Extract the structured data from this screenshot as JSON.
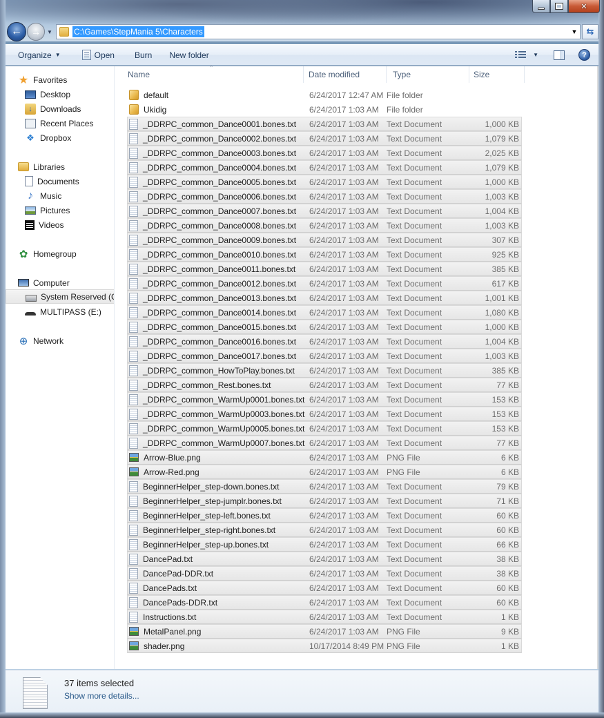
{
  "window": {
    "minimize_label": "Minimize",
    "maximize_label": "Maximize",
    "close_label": "Close"
  },
  "navbar": {
    "back_glyph": "←",
    "forward_glyph": "→",
    "recent_glyph": "▼",
    "address": "C:\\Games\\StepMania 5\\Characters",
    "address_dropdown_glyph": "▼",
    "refresh_glyph": "⇆"
  },
  "toolbar": {
    "organize": "Organize",
    "organize_arrow": "▼",
    "open": "Open",
    "burn": "Burn",
    "new_folder": "New folder",
    "views_arrow": "▼",
    "help_glyph": "?"
  },
  "sidebar": {
    "favorites": {
      "label": "Favorites",
      "items": [
        "Desktop",
        "Downloads",
        "Recent Places",
        "Dropbox"
      ]
    },
    "libraries": {
      "label": "Libraries",
      "items": [
        "Documents",
        "Music",
        "Pictures",
        "Videos"
      ]
    },
    "homegroup": {
      "label": "Homegroup"
    },
    "computer": {
      "label": "Computer",
      "items": [
        "System Reserved (C:",
        "MULTIPASS (E:)"
      ]
    },
    "network": {
      "label": "Network"
    }
  },
  "columns": {
    "name": "Name",
    "date": "Date modified",
    "type": "Type",
    "size": "Size",
    "sort_glyph": "^"
  },
  "files": [
    {
      "name": "default",
      "date": "6/24/2017 12:47 AM",
      "type": "File folder",
      "size": "",
      "icon": "folder",
      "selected": false
    },
    {
      "name": "Ukidig",
      "date": "6/24/2017 1:03 AM",
      "type": "File folder",
      "size": "",
      "icon": "folder",
      "selected": false
    },
    {
      "name": "_DDRPC_common_Dance0001.bones.txt",
      "date": "6/24/2017 1:03 AM",
      "type": "Text Document",
      "size": "1,000 KB",
      "icon": "txt",
      "selected": true
    },
    {
      "name": "_DDRPC_common_Dance0002.bones.txt",
      "date": "6/24/2017 1:03 AM",
      "type": "Text Document",
      "size": "1,079 KB",
      "icon": "txt",
      "selected": true
    },
    {
      "name": "_DDRPC_common_Dance0003.bones.txt",
      "date": "6/24/2017 1:03 AM",
      "type": "Text Document",
      "size": "2,025 KB",
      "icon": "txt",
      "selected": true
    },
    {
      "name": "_DDRPC_common_Dance0004.bones.txt",
      "date": "6/24/2017 1:03 AM",
      "type": "Text Document",
      "size": "1,079 KB",
      "icon": "txt",
      "selected": true
    },
    {
      "name": "_DDRPC_common_Dance0005.bones.txt",
      "date": "6/24/2017 1:03 AM",
      "type": "Text Document",
      "size": "1,000 KB",
      "icon": "txt",
      "selected": true
    },
    {
      "name": "_DDRPC_common_Dance0006.bones.txt",
      "date": "6/24/2017 1:03 AM",
      "type": "Text Document",
      "size": "1,003 KB",
      "icon": "txt",
      "selected": true
    },
    {
      "name": "_DDRPC_common_Dance0007.bones.txt",
      "date": "6/24/2017 1:03 AM",
      "type": "Text Document",
      "size": "1,004 KB",
      "icon": "txt",
      "selected": true
    },
    {
      "name": "_DDRPC_common_Dance0008.bones.txt",
      "date": "6/24/2017 1:03 AM",
      "type": "Text Document",
      "size": "1,003 KB",
      "icon": "txt",
      "selected": true
    },
    {
      "name": "_DDRPC_common_Dance0009.bones.txt",
      "date": "6/24/2017 1:03 AM",
      "type": "Text Document",
      "size": "307 KB",
      "icon": "txt",
      "selected": true
    },
    {
      "name": "_DDRPC_common_Dance0010.bones.txt",
      "date": "6/24/2017 1:03 AM",
      "type": "Text Document",
      "size": "925 KB",
      "icon": "txt",
      "selected": true
    },
    {
      "name": "_DDRPC_common_Dance0011.bones.txt",
      "date": "6/24/2017 1:03 AM",
      "type": "Text Document",
      "size": "385 KB",
      "icon": "txt",
      "selected": true
    },
    {
      "name": "_DDRPC_common_Dance0012.bones.txt",
      "date": "6/24/2017 1:03 AM",
      "type": "Text Document",
      "size": "617 KB",
      "icon": "txt",
      "selected": true
    },
    {
      "name": "_DDRPC_common_Dance0013.bones.txt",
      "date": "6/24/2017 1:03 AM",
      "type": "Text Document",
      "size": "1,001 KB",
      "icon": "txt",
      "selected": true
    },
    {
      "name": "_DDRPC_common_Dance0014.bones.txt",
      "date": "6/24/2017 1:03 AM",
      "type": "Text Document",
      "size": "1,080 KB",
      "icon": "txt",
      "selected": true
    },
    {
      "name": "_DDRPC_common_Dance0015.bones.txt",
      "date": "6/24/2017 1:03 AM",
      "type": "Text Document",
      "size": "1,000 KB",
      "icon": "txt",
      "selected": true
    },
    {
      "name": "_DDRPC_common_Dance0016.bones.txt",
      "date": "6/24/2017 1:03 AM",
      "type": "Text Document",
      "size": "1,004 KB",
      "icon": "txt",
      "selected": true
    },
    {
      "name": "_DDRPC_common_Dance0017.bones.txt",
      "date": "6/24/2017 1:03 AM",
      "type": "Text Document",
      "size": "1,003 KB",
      "icon": "txt",
      "selected": true
    },
    {
      "name": "_DDRPC_common_HowToPlay.bones.txt",
      "date": "6/24/2017 1:03 AM",
      "type": "Text Document",
      "size": "385 KB",
      "icon": "txt",
      "selected": true
    },
    {
      "name": "_DDRPC_common_Rest.bones.txt",
      "date": "6/24/2017 1:03 AM",
      "type": "Text Document",
      "size": "77 KB",
      "icon": "txt",
      "selected": true
    },
    {
      "name": "_DDRPC_common_WarmUp0001.bones.txt",
      "date": "6/24/2017 1:03 AM",
      "type": "Text Document",
      "size": "153 KB",
      "icon": "txt",
      "selected": true
    },
    {
      "name": "_DDRPC_common_WarmUp0003.bones.txt",
      "date": "6/24/2017 1:03 AM",
      "type": "Text Document",
      "size": "153 KB",
      "icon": "txt",
      "selected": true
    },
    {
      "name": "_DDRPC_common_WarmUp0005.bones.txt",
      "date": "6/24/2017 1:03 AM",
      "type": "Text Document",
      "size": "153 KB",
      "icon": "txt",
      "selected": true
    },
    {
      "name": "_DDRPC_common_WarmUp0007.bones.txt",
      "date": "6/24/2017 1:03 AM",
      "type": "Text Document",
      "size": "77 KB",
      "icon": "txt",
      "selected": true
    },
    {
      "name": "Arrow-Blue.png",
      "date": "6/24/2017 1:03 AM",
      "type": "PNG File",
      "size": "6 KB",
      "icon": "png",
      "selected": true
    },
    {
      "name": "Arrow-Red.png",
      "date": "6/24/2017 1:03 AM",
      "type": "PNG File",
      "size": "6 KB",
      "icon": "png",
      "selected": true
    },
    {
      "name": "BeginnerHelper_step-down.bones.txt",
      "date": "6/24/2017 1:03 AM",
      "type": "Text Document",
      "size": "79 KB",
      "icon": "txt",
      "selected": true
    },
    {
      "name": "BeginnerHelper_step-jumplr.bones.txt",
      "date": "6/24/2017 1:03 AM",
      "type": "Text Document",
      "size": "71 KB",
      "icon": "txt",
      "selected": true
    },
    {
      "name": "BeginnerHelper_step-left.bones.txt",
      "date": "6/24/2017 1:03 AM",
      "type": "Text Document",
      "size": "60 KB",
      "icon": "txt",
      "selected": true
    },
    {
      "name": "BeginnerHelper_step-right.bones.txt",
      "date": "6/24/2017 1:03 AM",
      "type": "Text Document",
      "size": "60 KB",
      "icon": "txt",
      "selected": true
    },
    {
      "name": "BeginnerHelper_step-up.bones.txt",
      "date": "6/24/2017 1:03 AM",
      "type": "Text Document",
      "size": "66 KB",
      "icon": "txt",
      "selected": true
    },
    {
      "name": "DancePad.txt",
      "date": "6/24/2017 1:03 AM",
      "type": "Text Document",
      "size": "38 KB",
      "icon": "txt",
      "selected": true
    },
    {
      "name": "DancePad-DDR.txt",
      "date": "6/24/2017 1:03 AM",
      "type": "Text Document",
      "size": "38 KB",
      "icon": "txt",
      "selected": true
    },
    {
      "name": "DancePads.txt",
      "date": "6/24/2017 1:03 AM",
      "type": "Text Document",
      "size": "60 KB",
      "icon": "txt",
      "selected": true
    },
    {
      "name": "DancePads-DDR.txt",
      "date": "6/24/2017 1:03 AM",
      "type": "Text Document",
      "size": "60 KB",
      "icon": "txt",
      "selected": true
    },
    {
      "name": "Instructions.txt",
      "date": "6/24/2017 1:03 AM",
      "type": "Text Document",
      "size": "1 KB",
      "icon": "txt",
      "selected": true
    },
    {
      "name": "MetalPanel.png",
      "date": "6/24/2017 1:03 AM",
      "type": "PNG File",
      "size": "9 KB",
      "icon": "png",
      "selected": true
    },
    {
      "name": "shader.png",
      "date": "10/17/2014 8:49 PM",
      "type": "PNG File",
      "size": "1 KB",
      "icon": "png",
      "selected": true
    }
  ],
  "details": {
    "count": "37 items selected",
    "link": "Show more details..."
  },
  "colors": {
    "selection_highlight": "#3399ff",
    "link": "#2a5a8a",
    "close_button": "#c85a36"
  }
}
